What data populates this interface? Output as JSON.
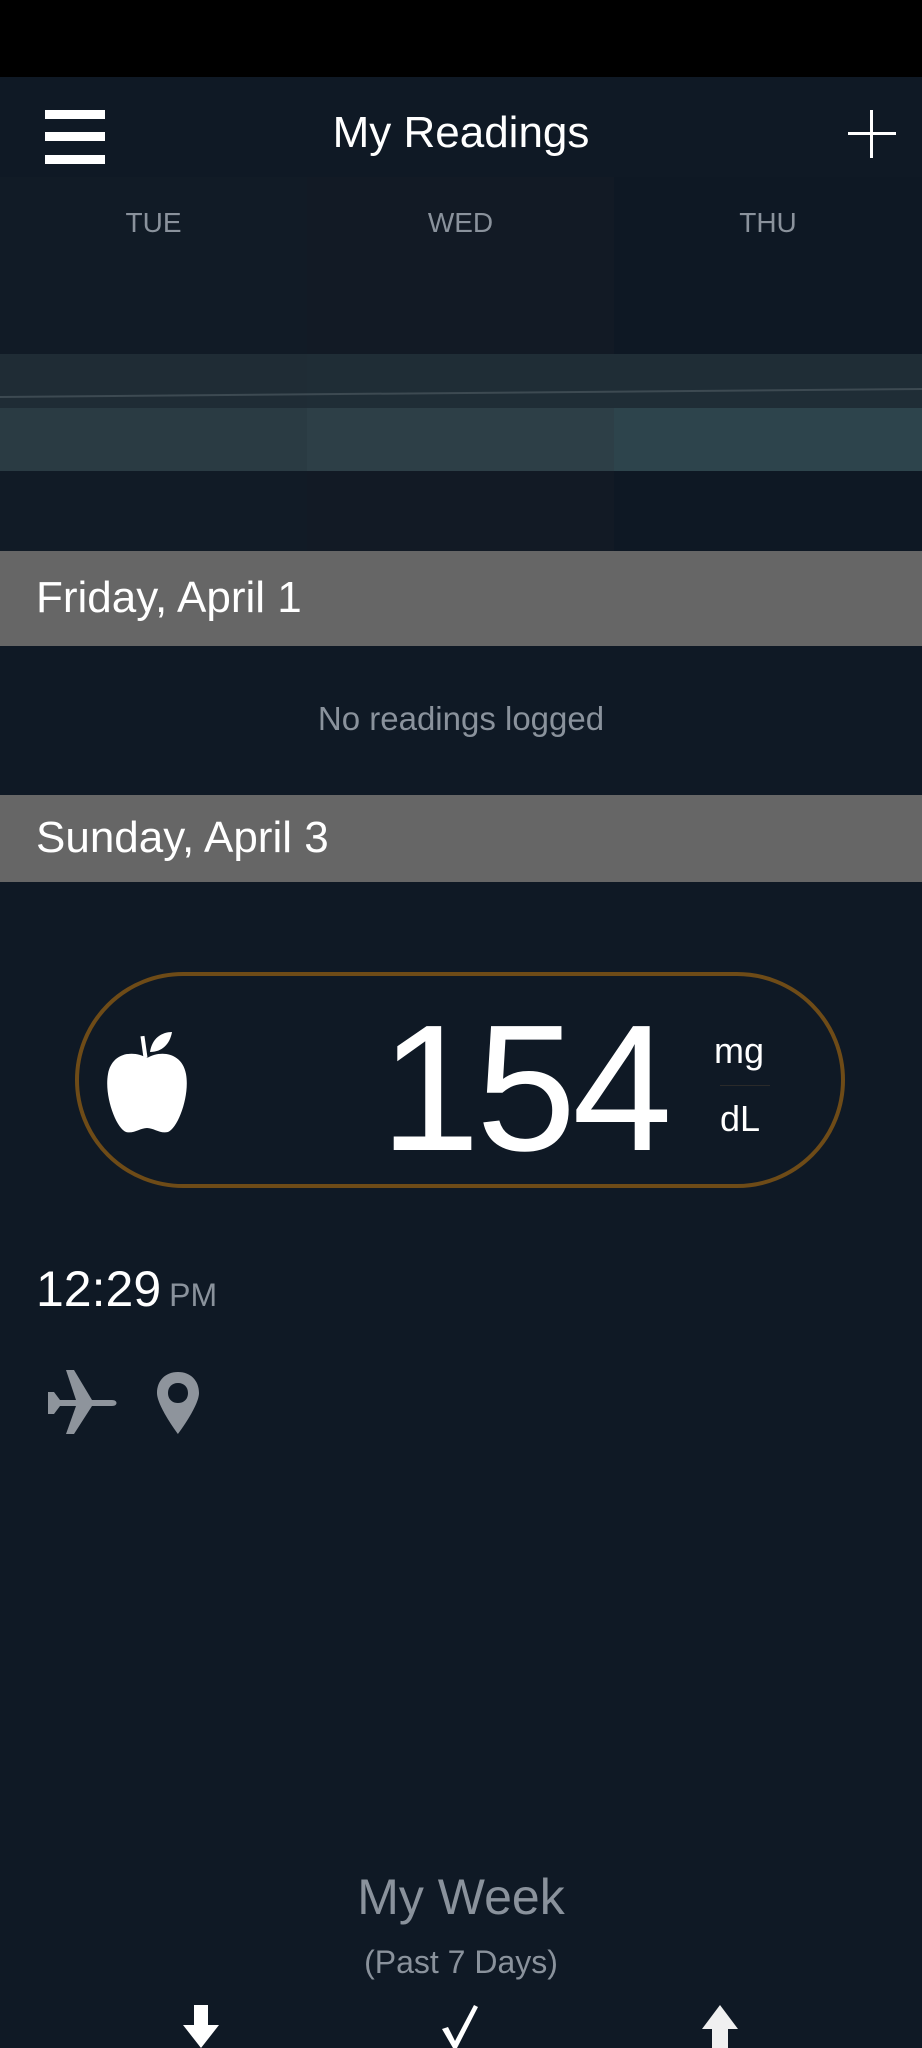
{
  "header": {
    "title": "My Readings",
    "menu_icon": "hamburger-menu-icon",
    "add_icon": "plus-icon"
  },
  "week_strip": {
    "days": [
      {
        "label": "TUE"
      },
      {
        "label": "WED"
      },
      {
        "label": "THU"
      }
    ]
  },
  "sections": [
    {
      "date": "Friday, April 1",
      "empty_text": "No readings logged"
    },
    {
      "date": "Sunday, April 3"
    }
  ],
  "reading": {
    "meal_icon": "apple-icon",
    "value": "154",
    "unit_top": "mg",
    "unit_bottom": "dL",
    "border_color": "#6e4b17",
    "time": "12:29",
    "ampm": "PM",
    "tag_icons": [
      "airplane-icon",
      "location-pin-icon"
    ]
  },
  "my_week": {
    "title": "My Week",
    "subtitle": "(Past 7 Days)",
    "stat_icons": [
      "arrow-down-icon",
      "checkmark-icon",
      "arrow-up-icon"
    ]
  },
  "colors": {
    "background": "#0f1925",
    "section_header": "#666666",
    "muted_text": "#8a929c"
  }
}
